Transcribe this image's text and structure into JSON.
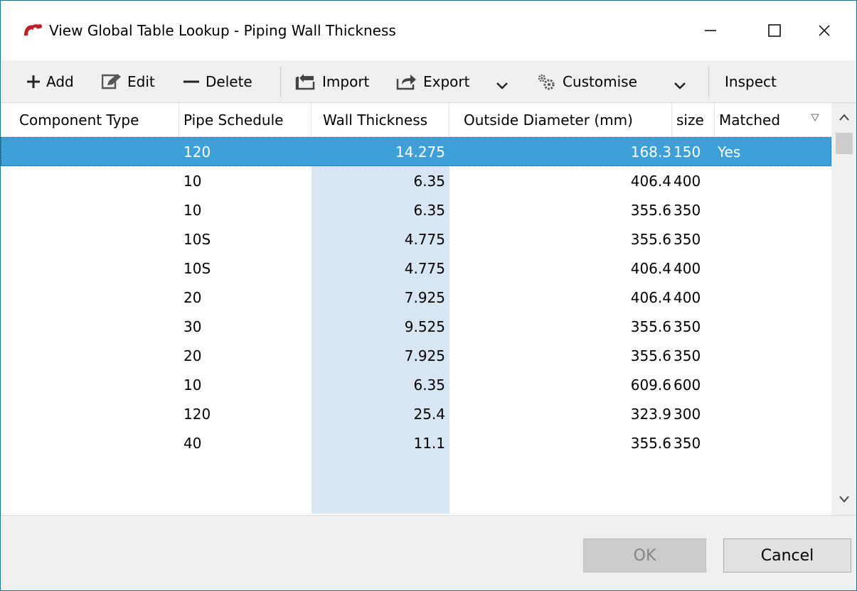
{
  "window": {
    "title": "View Global Table Lookup - Piping Wall Thickness"
  },
  "toolbar": {
    "add_label": "Add",
    "edit_label": "Edit",
    "delete_label": "Delete",
    "import_label": "Import",
    "export_label": "Export",
    "customise_label": "Customise",
    "inspect_label": "Inspect"
  },
  "table": {
    "columns": [
      "Component Type",
      "Pipe Schedule",
      "Wall Thickness",
      "Outside Diameter (mm)",
      "size",
      "Matched"
    ],
    "rows": [
      {
        "component_type": "",
        "pipe_schedule": "120",
        "wall_thickness": "14.275",
        "outside_diameter": "168.3",
        "size": "150",
        "matched": "Yes",
        "selected": true
      },
      {
        "component_type": "",
        "pipe_schedule": "10",
        "wall_thickness": "6.35",
        "outside_diameter": "406.4",
        "size": "400",
        "matched": ""
      },
      {
        "component_type": "",
        "pipe_schedule": "10",
        "wall_thickness": "6.35",
        "outside_diameter": "355.6",
        "size": "350",
        "matched": ""
      },
      {
        "component_type": "",
        "pipe_schedule": "10S",
        "wall_thickness": "4.775",
        "outside_diameter": "355.6",
        "size": "350",
        "matched": ""
      },
      {
        "component_type": "",
        "pipe_schedule": "10S",
        "wall_thickness": "4.775",
        "outside_diameter": "406.4",
        "size": "400",
        "matched": ""
      },
      {
        "component_type": "",
        "pipe_schedule": "20",
        "wall_thickness": "7.925",
        "outside_diameter": "406.4",
        "size": "400",
        "matched": ""
      },
      {
        "component_type": "",
        "pipe_schedule": "30",
        "wall_thickness": "9.525",
        "outside_diameter": "355.6",
        "size": "350",
        "matched": ""
      },
      {
        "component_type": "",
        "pipe_schedule": "20",
        "wall_thickness": "7.925",
        "outside_diameter": "355.6",
        "size": "350",
        "matched": ""
      },
      {
        "component_type": "",
        "pipe_schedule": "10",
        "wall_thickness": "6.35",
        "outside_diameter": "609.6",
        "size": "600",
        "matched": ""
      },
      {
        "component_type": "",
        "pipe_schedule": "120",
        "wall_thickness": "25.4",
        "outside_diameter": "323.9",
        "size": "300",
        "matched": ""
      },
      {
        "component_type": "",
        "pipe_schedule": "40",
        "wall_thickness": "11.1",
        "outside_diameter": "355.6",
        "size": "350",
        "matched": ""
      }
    ]
  },
  "footer": {
    "ok_label": "OK",
    "cancel_label": "Cancel"
  },
  "colors": {
    "selection": "#3fa0d8",
    "wall_column_highlight": "#d8e6f3",
    "app_icon": "#c0202a"
  },
  "icons": [
    "app-logo-icon",
    "minimize-icon",
    "maximize-icon",
    "close-icon",
    "plus-icon",
    "edit-icon",
    "minus-icon",
    "import-icon",
    "export-icon",
    "dropdown-chevron-icon",
    "gear-icon",
    "sort-triangle-icon",
    "scroll-up-icon",
    "scroll-down-icon"
  ]
}
